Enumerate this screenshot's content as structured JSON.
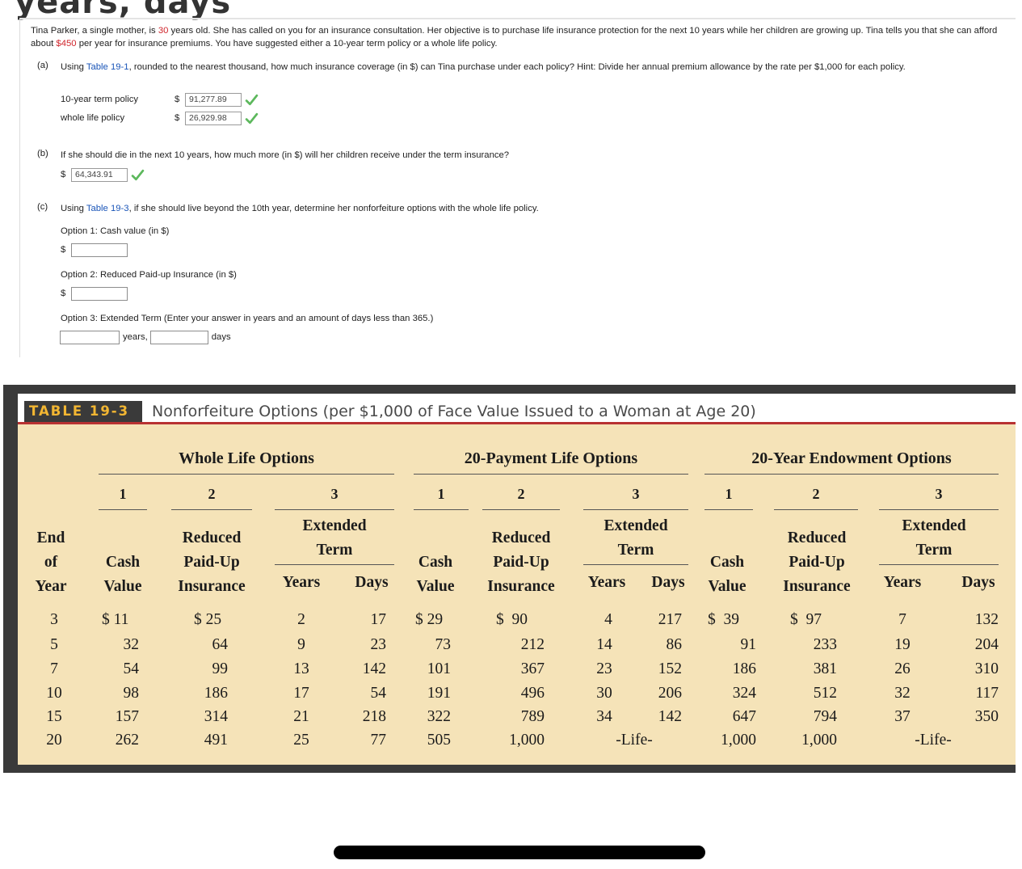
{
  "header_fragment": "years, days",
  "question": {
    "pre1": "Tina Parker, a single mother, is ",
    "age": "30",
    "mid1": " years old. She has called on you for an insurance consultation. Her objective is to purchase life insurance protection for the next 10 years while her children are growing up. Tina tells you that she can afford about ",
    "premium": "$450",
    "post1": " per year for insurance premiums. You have suggested either a 10-year term policy or a whole life policy."
  },
  "part_a": {
    "label": "(a)",
    "text_pre": "Using ",
    "table_link": "Table 19-1",
    "text_post": ", rounded to the nearest thousand, how much insurance coverage (in $) can Tina purchase under each policy? Hint: Divide her annual premium allowance by the rate per $1,000 for each policy.",
    "rows": [
      {
        "label": "10-year term policy",
        "currency": "$",
        "value": "91,277.89"
      },
      {
        "label": "whole life policy",
        "currency": "$",
        "value": "26,929.98"
      }
    ]
  },
  "part_b": {
    "label": "(b)",
    "text": "If she should die in the next 10 years, how much more (in $) will her children receive under the term insurance?",
    "currency": "$",
    "value": "64,343.91"
  },
  "part_c": {
    "label": "(c)",
    "text_pre": "Using ",
    "table_link": "Table 19-3",
    "text_post": ", if she should live beyond the 10th year, determine her nonforfeiture options with the whole life policy.",
    "option1": {
      "label": "Option 1: Cash value (in $)",
      "currency": "$",
      "value": ""
    },
    "option2": {
      "label": "Option 2: Reduced Paid-up Insurance (in $)",
      "currency": "$",
      "value": ""
    },
    "option3": {
      "label": "Option 3: Extended Term (Enter your answer in years and an amount of days less than 365.)",
      "years_unit": "years,",
      "days_unit": "days",
      "years_value": "",
      "days_value": ""
    }
  },
  "table": {
    "tag": "TABLE 19-3",
    "title": "Nonforfeiture Options (per $1,000 of Face Value Issued to a Woman at Age 20)",
    "groups": [
      "Whole Life Options",
      "20-Payment Life Options",
      "20-Year Endowment Options"
    ],
    "option_numbers": [
      "1",
      "2",
      "3"
    ],
    "end_of_year_header": [
      "End",
      "of",
      "Year"
    ],
    "cash_value_header": [
      "Cash",
      "Value"
    ],
    "reduced_header": [
      "Reduced",
      "Paid-Up",
      "Insurance"
    ],
    "extended_header": [
      "Extended",
      "Term"
    ],
    "years_header": "Years",
    "days_header": "Days",
    "rows": [
      {
        "year": "3",
        "wl_cash": "$ 11",
        "wl_reduced": "$ 25",
        "wl_years": "2",
        "wl_days": "17",
        "p20_cash": "$ 29",
        "p20_reduced": "$  90",
        "p20_years": "4",
        "p20_days": "217",
        "end_cash": "$  39",
        "end_reduced": "$  97",
        "end_years": "7",
        "end_days": "132"
      },
      {
        "year": "5",
        "wl_cash": "32",
        "wl_reduced": "64",
        "wl_years": "9",
        "wl_days": "23",
        "p20_cash": "73",
        "p20_reduced": "212",
        "p20_years": "14",
        "p20_days": "86",
        "end_cash": "91",
        "end_reduced": "233",
        "end_years": "19",
        "end_days": "204"
      },
      {
        "year": "7",
        "wl_cash": "54",
        "wl_reduced": "99",
        "wl_years": "13",
        "wl_days": "142",
        "p20_cash": "101",
        "p20_reduced": "367",
        "p20_years": "23",
        "p20_days": "152",
        "end_cash": "186",
        "end_reduced": "381",
        "end_years": "26",
        "end_days": "310"
      },
      {
        "year": "10",
        "wl_cash": "98",
        "wl_reduced": "186",
        "wl_years": "17",
        "wl_days": "54",
        "p20_cash": "191",
        "p20_reduced": "496",
        "p20_years": "30",
        "p20_days": "206",
        "end_cash": "324",
        "end_reduced": "512",
        "end_years": "32",
        "end_days": "117"
      },
      {
        "year": "15",
        "wl_cash": "157",
        "wl_reduced": "314",
        "wl_years": "21",
        "wl_days": "218",
        "p20_cash": "322",
        "p20_reduced": "789",
        "p20_years": "34",
        "p20_days": "142",
        "end_cash": "647",
        "end_reduced": "794",
        "end_years": "37",
        "end_days": "350"
      },
      {
        "year": "20",
        "wl_cash": "262",
        "wl_reduced": "491",
        "wl_years": "25",
        "wl_days": "77",
        "p20_cash": "505",
        "p20_reduced": "1,000",
        "p20_life": "-Life-",
        "end_cash": "1,000",
        "end_reduced": "1,000",
        "end_life": "-Life-"
      }
    ]
  },
  "colors": {
    "accent_red": "#d0262d",
    "link_blue": "#1a55b8",
    "check_green": "#5cb85c",
    "table_bg": "#f5e3b8",
    "tag_text": "#f2b632"
  }
}
